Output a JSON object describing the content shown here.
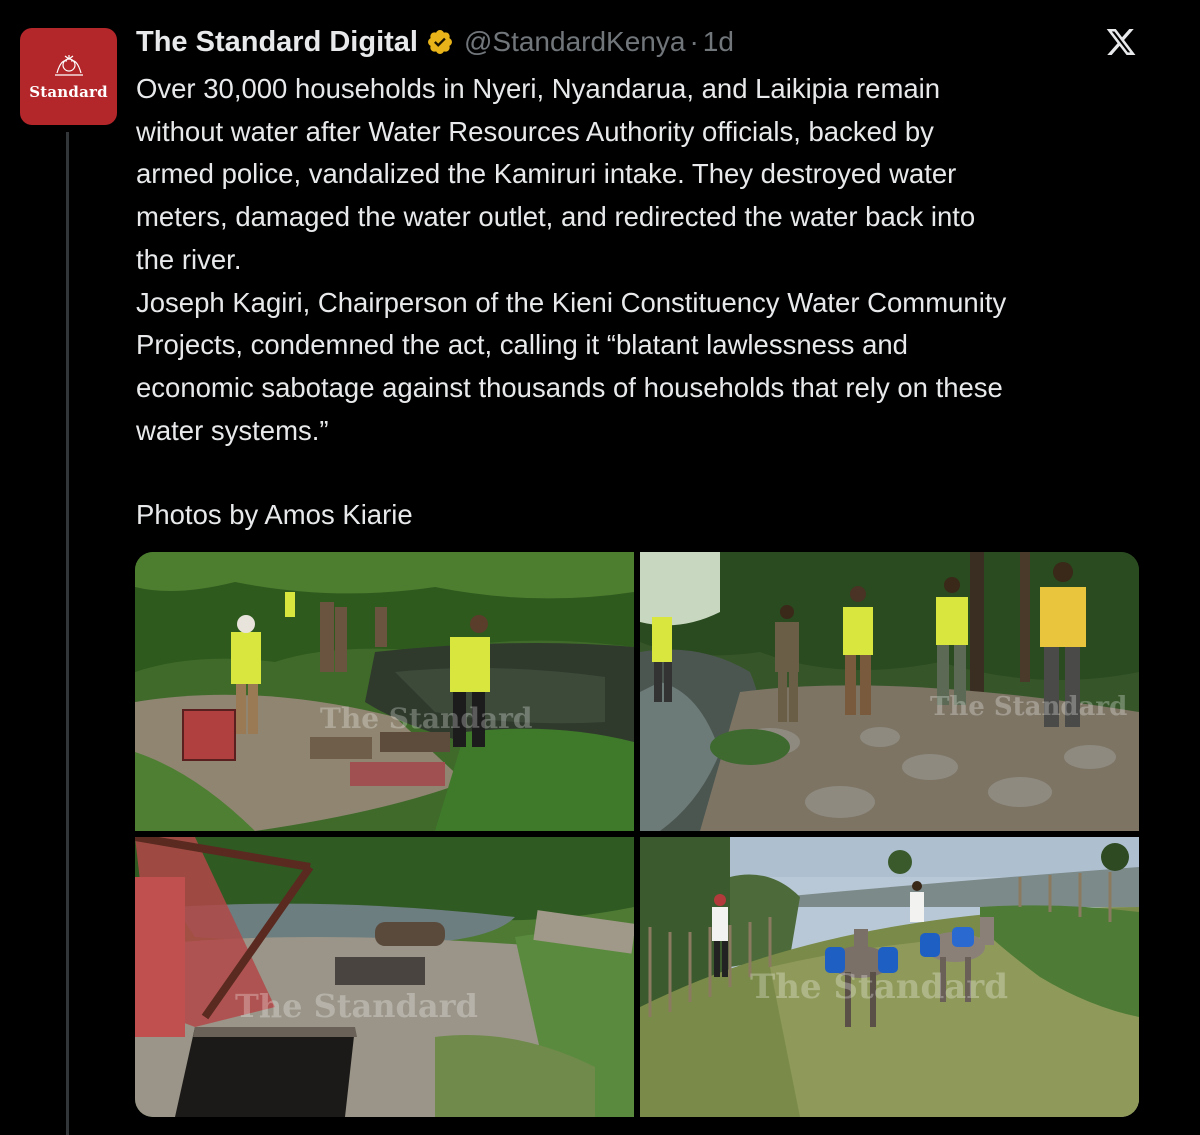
{
  "account": {
    "display_name": "The Standard Digital",
    "handle": "@StandardKenya",
    "separator": "·",
    "time": "1d",
    "avatar_text": "Standard",
    "avatar_color": "#b3262a",
    "verified_color": "#e8b419"
  },
  "tweet": {
    "lines": [
      "Over 30,000 households in Nyeri, Nyandarua, and Laikipia remain",
      "without water after Water Resources Authority officials, backed by",
      "armed police, vandalized the Kamiruri intake. They destroyed water",
      "meters, damaged the water outlet, and redirected the water back into",
      "the river.",
      "Joseph Kagiri, Chairperson of the Kieni Constituency Water Community",
      "Projects, condemned the act, calling it “blatant lawlessness and",
      "economic sabotage against thousands of households that rely on these",
      "water systems.”"
    ],
    "credit": "Photos by Amos Kiarie"
  },
  "media": {
    "watermark_text": "The Standard",
    "photos": [
      {
        "subject": "officials-at-intake-pond"
      },
      {
        "subject": "officers-on-riverbed"
      },
      {
        "subject": "damaged-intake-chamber"
      },
      {
        "subject": "donkeys-carrying-water"
      }
    ]
  },
  "icons": {
    "verified": "verified-badge-icon",
    "platform": "x-logo-icon"
  }
}
